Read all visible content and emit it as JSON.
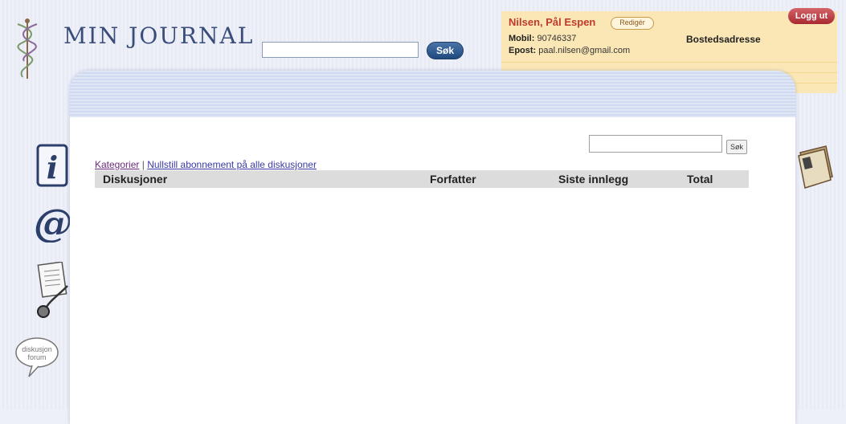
{
  "app": {
    "title": "MIN JOURNAL"
  },
  "search": {
    "button_label": "Søk",
    "value": ""
  },
  "user": {
    "name": "Nilsen, Pål Espen",
    "edit_label": "Redigér",
    "mobile_label": "Mobil:",
    "mobile": "90746337",
    "email_label": "Epost:",
    "email": "paal.nilsen@gmail.com",
    "address_label": "Bostedsadresse",
    "logout_label": "Logg ut"
  },
  "sidebar": {
    "forum_label_1": "diskusjon",
    "forum_label_2": "forum"
  },
  "forum": {
    "search_button": "Søk",
    "search_value": "",
    "categories_link": "Kategorier",
    "separator": "|",
    "reset_link": "Nullstill abonnement på alle diskusjoner",
    "columns": [
      "Diskusjoner",
      "Forfatter",
      "Siste innlegg",
      "Total"
    ]
  },
  "colors": {
    "accent": "#1e4a7e",
    "userbox": "#fbe7b6",
    "user_name": "#c0392b",
    "logout": "#a82a30",
    "header_row": "#dcdcdc"
  }
}
